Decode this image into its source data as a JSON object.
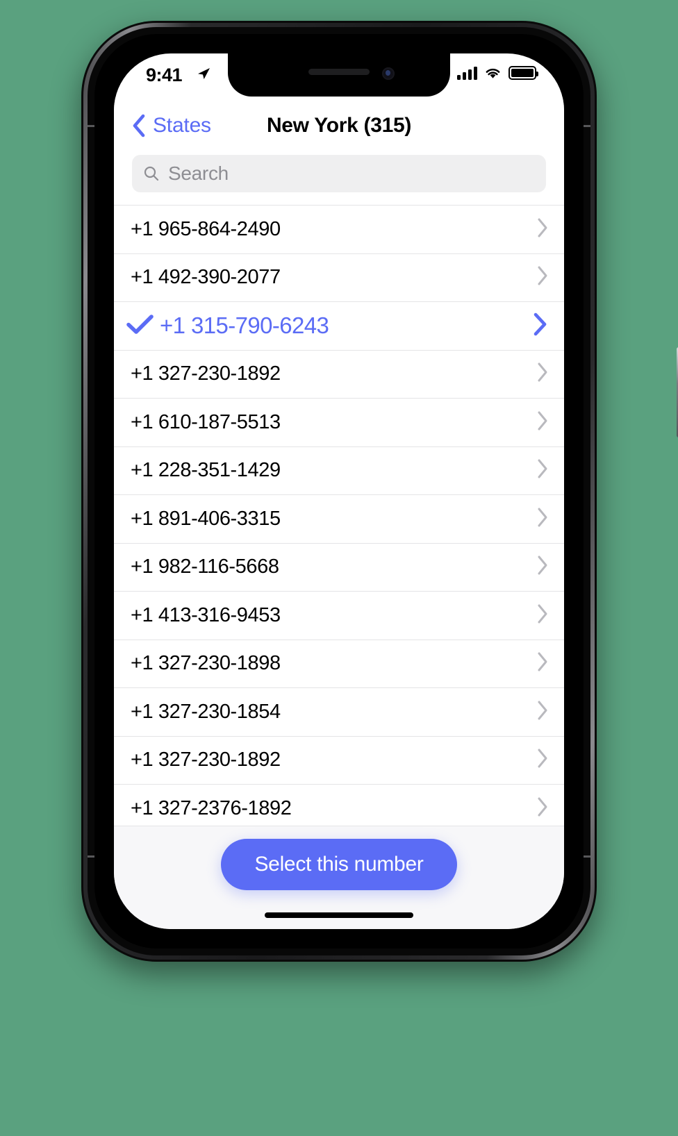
{
  "theme": {
    "accent": "#5b6cf5",
    "separator": "#e4e4e6",
    "footer_bg": "#f7f7f9",
    "search_bg": "#efeff0",
    "placeholder_color": "#8e8e93",
    "chevron_color": "#b9b9be"
  },
  "status_bar": {
    "time": "9:41",
    "location_icon": "location-arrow-icon",
    "signal_icon": "cellular-signal-icon",
    "wifi_icon": "wifi-icon",
    "battery_icon": "battery-full-icon"
  },
  "nav": {
    "back_icon": "chevron-left-icon",
    "back_label": "States",
    "title": "New York (315)"
  },
  "search": {
    "icon": "search-icon",
    "placeholder": "Search",
    "value": ""
  },
  "list": {
    "chevron_icon": "chevron-right-icon",
    "check_icon": "checkmark-icon",
    "rows": [
      {
        "number": "+1 965-864-2490",
        "selected": false
      },
      {
        "number": "+1 492-390-2077",
        "selected": false
      },
      {
        "number": "+1 315-790-6243",
        "selected": true
      },
      {
        "number": "+1 327-230-1892",
        "selected": false
      },
      {
        "number": "+1 610-187-5513",
        "selected": false
      },
      {
        "number": "+1 228-351-1429",
        "selected": false
      },
      {
        "number": "+1 891-406-3315",
        "selected": false
      },
      {
        "number": "+1 982-116-5668",
        "selected": false
      },
      {
        "number": "+1 413-316-9453",
        "selected": false
      },
      {
        "number": "+1 327-230-1898",
        "selected": false
      },
      {
        "number": "+1 327-230-1854",
        "selected": false
      },
      {
        "number": "+1 327-230-1892",
        "selected": false
      },
      {
        "number": "+1 327-2376-1892",
        "selected": false
      }
    ]
  },
  "footer": {
    "select_button_label": "Select this number"
  }
}
